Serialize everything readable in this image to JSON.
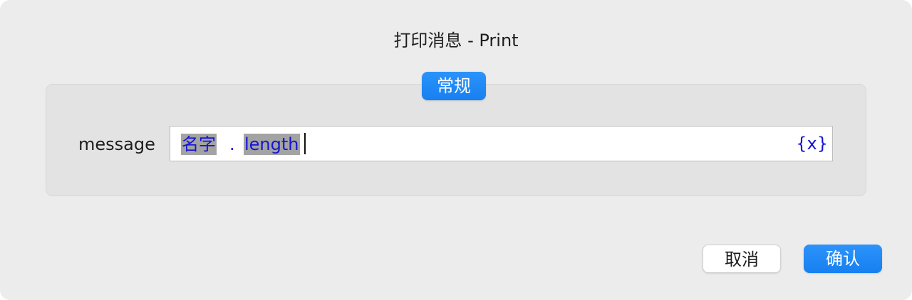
{
  "dialog": {
    "title": "打印消息 - Print"
  },
  "tabs": [
    {
      "label": "常规",
      "selected": true
    }
  ],
  "form": {
    "message_label": "message",
    "message_tokens": [
      "名字",
      ".",
      "length"
    ],
    "variable_icon_text": "{x}"
  },
  "buttons": {
    "cancel_label": "取消",
    "confirm_label": "确认"
  },
  "colors": {
    "accent": "#1a86f5",
    "token_text": "#1414d8",
    "token_highlight": "#a3a3a3",
    "dialog_bg": "#ececec"
  },
  "icons": {
    "variable": "variable-insert-icon"
  }
}
